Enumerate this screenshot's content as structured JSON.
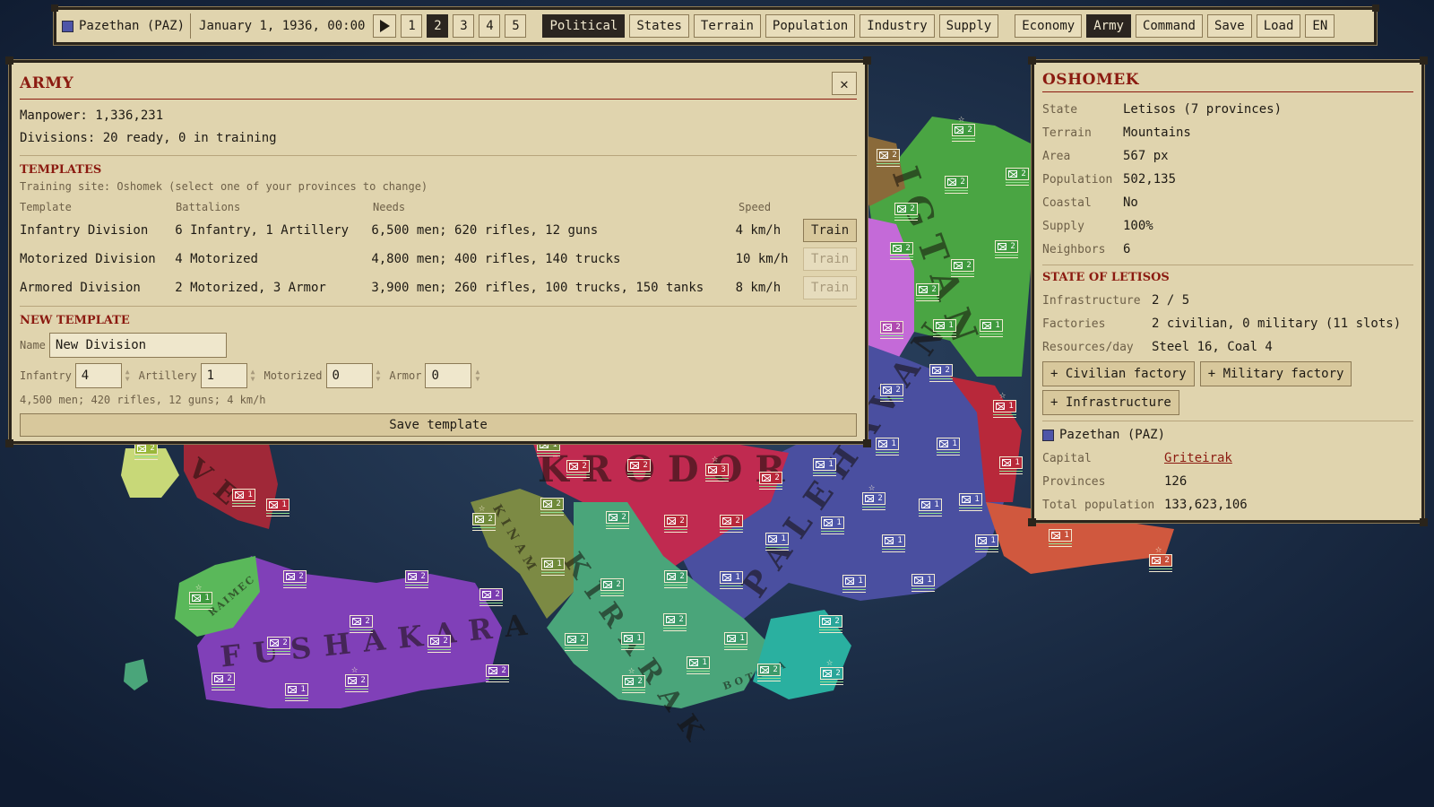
{
  "topbar": {
    "country": "Pazethan (PAZ)",
    "flag_color": "#4e55a8",
    "date": "January 1, 1936, 00:00",
    "play_icon": "play-icon",
    "speeds": [
      "1",
      "2",
      "3",
      "4",
      "5"
    ],
    "active_speed": "2",
    "map_modes": [
      "Political",
      "States",
      "Terrain",
      "Population",
      "Industry",
      "Supply"
    ],
    "active_map_mode": "Political",
    "panels": [
      "Economy",
      "Army",
      "Command"
    ],
    "active_panel": "Army",
    "save": "Save",
    "load": "Load",
    "language": "EN"
  },
  "army": {
    "title": "ARMY",
    "manpower": "Manpower: 1,336,231",
    "divisions": "Divisions: 20 ready, 0 in training",
    "templates_title": "TEMPLATES",
    "training_site": "Training site: Oshomek (select one of your provinces to change)",
    "columns": [
      "Template",
      "Battalions",
      "Needs",
      "Speed"
    ],
    "templates": [
      {
        "name": "Infantry Division",
        "battalions": "6 Infantry, 1 Artillery",
        "needs": "6,500 men; 620 rifles, 12 guns",
        "speed": "4 km/h",
        "action": "Train",
        "enabled": true
      },
      {
        "name": "Motorized Division",
        "battalions": "4 Motorized",
        "needs": "4,800 men; 400 rifles, 140 trucks",
        "speed": "10 km/h",
        "action": "Train",
        "enabled": false
      },
      {
        "name": "Armored Division",
        "battalions": "2 Motorized, 3 Armor",
        "needs": "3,900 men; 260 rifles, 100 trucks, 150 tanks",
        "speed": "8 km/h",
        "action": "Train",
        "enabled": false
      }
    ],
    "new_template": {
      "title": "NEW TEMPLATE",
      "name_label": "Name",
      "name_value": "New Division",
      "infantry_label": "Infantry",
      "infantry_value": "4",
      "artillery_label": "Artillery",
      "artillery_value": "1",
      "motorized_label": "Motorized",
      "motorized_value": "0",
      "armor_label": "Armor",
      "armor_value": "0",
      "summary": "4,500 men; 420 rifles, 12 guns; 4 km/h",
      "save_label": "Save template"
    }
  },
  "province": {
    "title": "OSHOMEK",
    "rows": [
      {
        "k": "State",
        "v": "Letisos (7 provinces)"
      },
      {
        "k": "Terrain",
        "v": "Mountains"
      },
      {
        "k": "Area",
        "v": "567 px"
      },
      {
        "k": "Population",
        "v": "502,135"
      },
      {
        "k": "Coastal",
        "v": "No"
      },
      {
        "k": "Supply",
        "v": "100%"
      },
      {
        "k": "Neighbors",
        "v": "6"
      }
    ],
    "state_title": "STATE OF LETISOS",
    "state_rows": [
      {
        "k": "Infrastructure",
        "v": "2 / 5"
      },
      {
        "k": "Factories",
        "v": "2 civilian, 0 military (11 slots)"
      },
      {
        "k": "Resources/day",
        "v": "Steel 16, Coal 4"
      }
    ],
    "actions": [
      "+ Civilian factory",
      "+ Military factory",
      "+ Infrastructure"
    ],
    "owner": "Pazethan (PAZ)",
    "owner_rows": [
      {
        "k": "Capital",
        "v": "Griteirak",
        "link": true
      },
      {
        "k": "Provinces",
        "v": "126"
      },
      {
        "k": "Total population",
        "v": "133,623,106"
      }
    ]
  },
  "map": {
    "labels": [
      "IGTAN",
      "KRODOR",
      "PALEHAVAN",
      "FUSHAKARA",
      "KIRARAK",
      "RAIMEC",
      "BOTOVA",
      "KINAM",
      "VE"
    ],
    "units": [
      {
        "n": "2",
        "c": "#3f9a3f"
      },
      {
        "n": "2",
        "c": "#3f9a3f"
      },
      {
        "n": "2",
        "c": "#3f9a3f"
      },
      {
        "n": "2",
        "c": "#3f9a3f"
      },
      {
        "n": "2",
        "c": "#3f9a3f"
      },
      {
        "n": "2",
        "c": "#3f9a3f"
      },
      {
        "n": "2",
        "c": "#3f9a3f"
      },
      {
        "n": "1",
        "c": "#3f9a3f"
      },
      {
        "n": "1",
        "c": "#3f9a3f"
      },
      {
        "n": "2",
        "c": "#3f9a3f"
      },
      {
        "n": "2",
        "c": "#8a6a3a"
      },
      {
        "n": "2",
        "c": "#b04ab0"
      },
      {
        "n": "2",
        "c": "#4e55a8"
      },
      {
        "n": "2",
        "c": "#4e55a8"
      },
      {
        "n": "1",
        "c": "#4e55a8"
      },
      {
        "n": "1",
        "c": "#4e55a8"
      },
      {
        "n": "1",
        "c": "#b8283a"
      },
      {
        "n": "1",
        "c": "#b8283a"
      },
      {
        "n": "3",
        "c": "#b8283a"
      },
      {
        "n": "2",
        "c": "#b8283a"
      },
      {
        "n": "2",
        "c": "#b8283a"
      },
      {
        "n": "2",
        "c": "#b8283a"
      },
      {
        "n": "2",
        "c": "#b8283a"
      },
      {
        "n": "2",
        "c": "#b8283a"
      },
      {
        "n": "1",
        "c": "#4e55a8"
      },
      {
        "n": "2",
        "c": "#4e55a8"
      },
      {
        "n": "1",
        "c": "#4e55a8"
      },
      {
        "n": "1",
        "c": "#4e55a8"
      },
      {
        "n": "1",
        "c": "#4e55a8"
      },
      {
        "n": "1",
        "c": "#4e55a8"
      },
      {
        "n": "1",
        "c": "#4e55a8"
      },
      {
        "n": "1",
        "c": "#4e55a8"
      },
      {
        "n": "1",
        "c": "#4e55a8"
      },
      {
        "n": "1",
        "c": "#4e55a8"
      },
      {
        "n": "1",
        "c": "#4e55a8"
      },
      {
        "n": "1",
        "c": "#c8503a"
      },
      {
        "n": "1",
        "c": "#c8503a"
      },
      {
        "n": "2",
        "c": "#c8503a"
      },
      {
        "n": "1",
        "c": "#6f8a3a"
      },
      {
        "n": "2",
        "c": "#6f8a3a"
      },
      {
        "n": "2",
        "c": "#6f8a3a"
      },
      {
        "n": "1",
        "c": "#6f8a3a"
      },
      {
        "n": "2",
        "c": "#3c9a6a"
      },
      {
        "n": "2",
        "c": "#3c9a6a"
      },
      {
        "n": "2",
        "c": "#3c9a6a"
      },
      {
        "n": "2",
        "c": "#3c9a6a"
      },
      {
        "n": "2",
        "c": "#3c9a6a"
      },
      {
        "n": "1",
        "c": "#3c9a6a"
      },
      {
        "n": "1",
        "c": "#3c9a6a"
      },
      {
        "n": "1",
        "c": "#3c9a6a"
      },
      {
        "n": "2",
        "c": "#3c9a6a"
      },
      {
        "n": "2",
        "c": "#3c9a6a"
      },
      {
        "n": "2",
        "c": "#2aa69a"
      },
      {
        "n": "2",
        "c": "#2aa69a"
      },
      {
        "n": "2",
        "c": "#7a3cb0"
      },
      {
        "n": "2",
        "c": "#7a3cb0"
      },
      {
        "n": "2",
        "c": "#7a3cb0"
      },
      {
        "n": "2",
        "c": "#7a3cb0"
      },
      {
        "n": "2",
        "c": "#7a3cb0"
      },
      {
        "n": "2",
        "c": "#7a3cb0"
      },
      {
        "n": "2",
        "c": "#7a3cb0"
      },
      {
        "n": "2",
        "c": "#7a3cb0"
      },
      {
        "n": "1",
        "c": "#7a3cb0"
      },
      {
        "n": "2",
        "c": "#7a3cb0"
      },
      {
        "n": "1",
        "c": "#3f9a3f"
      },
      {
        "n": "2",
        "c": "#9ab83a"
      },
      {
        "n": "1",
        "c": "#b8283a"
      },
      {
        "n": "1",
        "c": "#b8283a"
      }
    ]
  }
}
